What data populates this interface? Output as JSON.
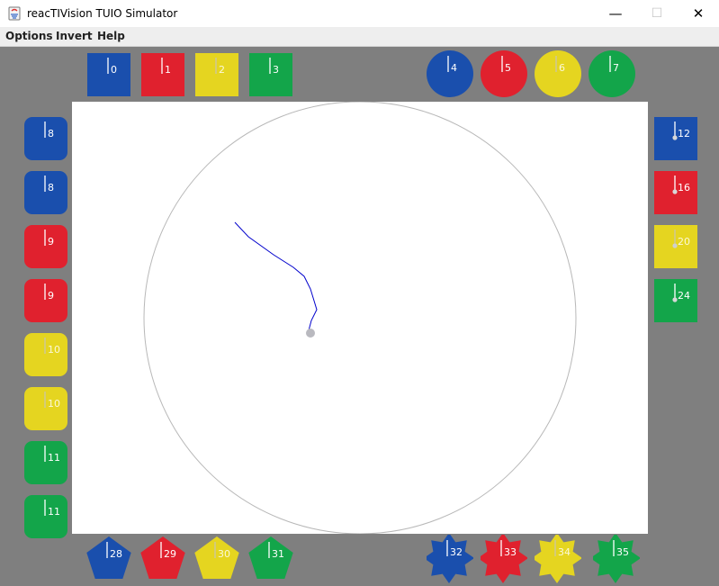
{
  "window": {
    "title": "reacTIVision TUIO Simulator",
    "controls": {
      "minimize": "—",
      "maximize": "☐",
      "close": "✕"
    }
  },
  "menu": {
    "options": "Options",
    "invert": "Invert",
    "help": "Help"
  },
  "colors": {
    "blue": "#1a4fad",
    "red": "#e0212e",
    "yellow": "#e5d520",
    "green": "#13a54a",
    "background": "#7f7f7f",
    "table": "#ffffff",
    "trail": "#0000cc"
  },
  "fiducials": {
    "top_squares": [
      {
        "id": "0",
        "color": "blue"
      },
      {
        "id": "1",
        "color": "red"
      },
      {
        "id": "2",
        "color": "yellow"
      },
      {
        "id": "3",
        "color": "green"
      }
    ],
    "top_circles": [
      {
        "id": "4",
        "color": "blue"
      },
      {
        "id": "5",
        "color": "red"
      },
      {
        "id": "6",
        "color": "yellow"
      },
      {
        "id": "7",
        "color": "green"
      }
    ],
    "left_rounded": [
      {
        "id": "8",
        "color": "blue"
      },
      {
        "id": "8",
        "color": "blue"
      },
      {
        "id": "9",
        "color": "red"
      },
      {
        "id": "9",
        "color": "red"
      },
      {
        "id": "10",
        "color": "yellow"
      },
      {
        "id": "10",
        "color": "yellow"
      },
      {
        "id": "11",
        "color": "green"
      },
      {
        "id": "11",
        "color": "green"
      }
    ],
    "right_squares": [
      {
        "id": "12",
        "color": "blue"
      },
      {
        "id": "16",
        "color": "red"
      },
      {
        "id": "20",
        "color": "yellow"
      },
      {
        "id": "24",
        "color": "green"
      }
    ],
    "bottom_pentagons": [
      {
        "id": "28",
        "color": "blue"
      },
      {
        "id": "29",
        "color": "red"
      },
      {
        "id": "30",
        "color": "yellow"
      },
      {
        "id": "31",
        "color": "green"
      }
    ],
    "bottom_stars": [
      {
        "id": "32",
        "color": "blue"
      },
      {
        "id": "33",
        "color": "red"
      },
      {
        "id": "34",
        "color": "yellow"
      },
      {
        "id": "35",
        "color": "green"
      }
    ]
  }
}
